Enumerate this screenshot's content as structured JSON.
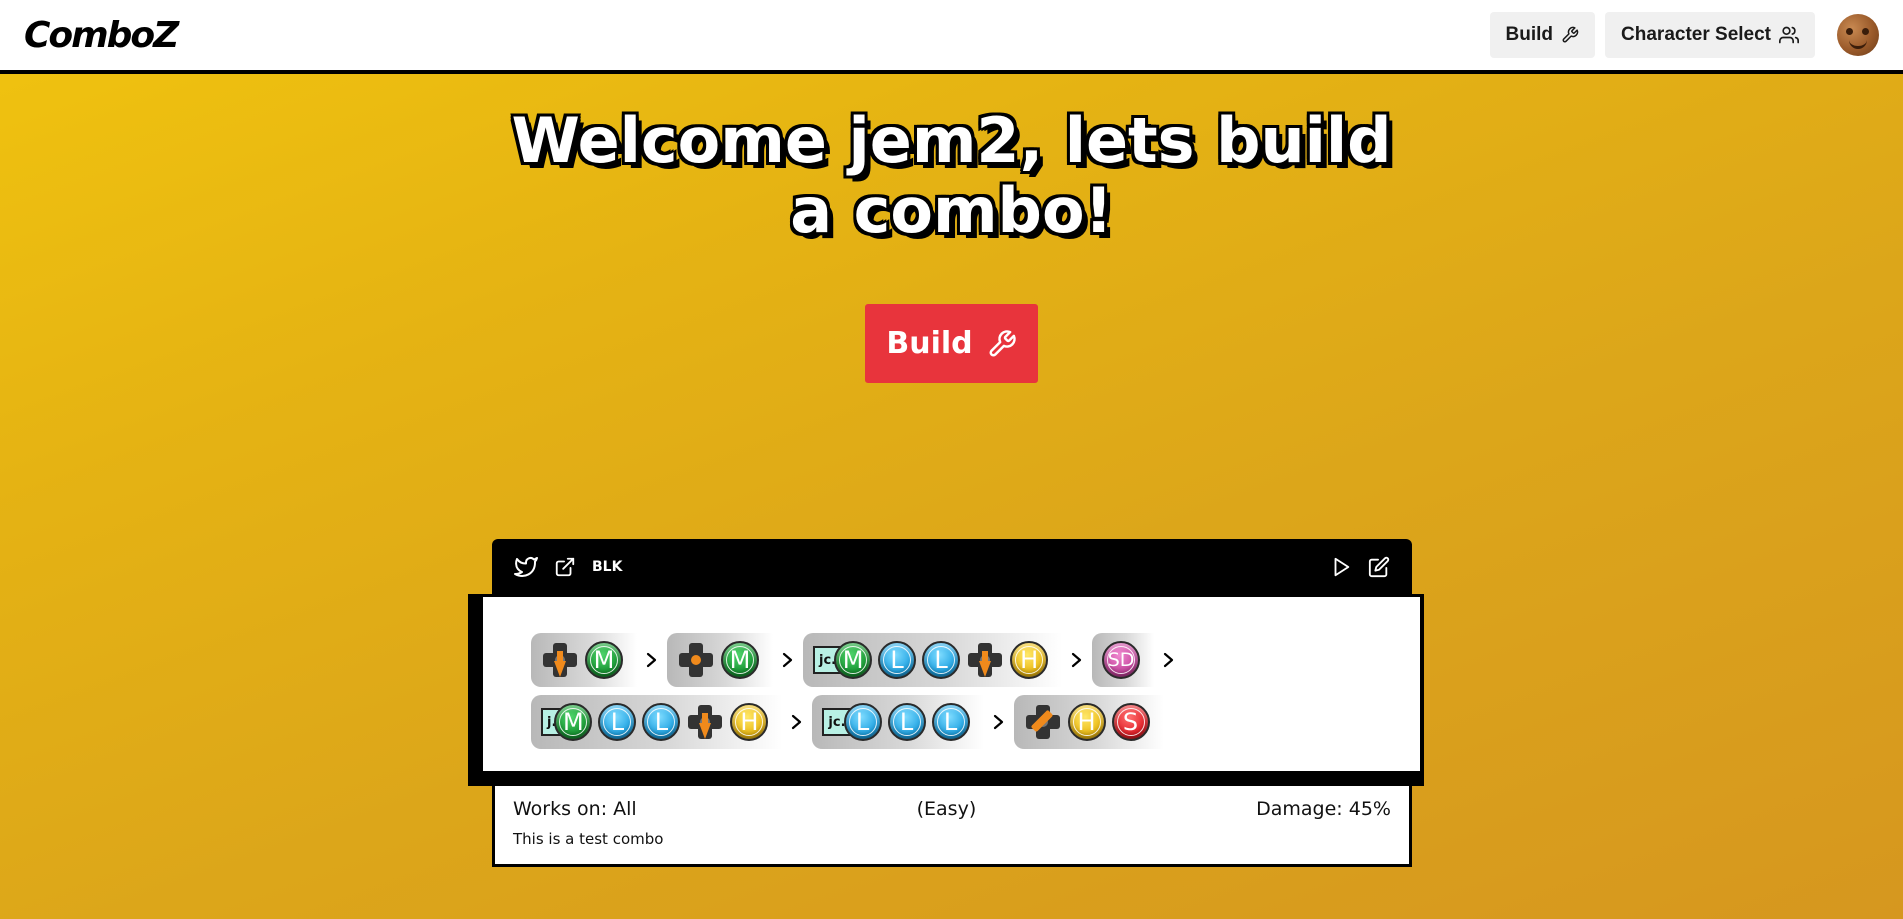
{
  "app": {
    "logo_text": "ComboZ"
  },
  "nav": {
    "build_label": "Build",
    "build_icon": "wrench-icon",
    "character_select_label": "Character Select",
    "character_select_icon": "users-icon"
  },
  "hero": {
    "title_line1": "Welcome jem2, lets build",
    "title_line2": "a combo!",
    "build_button_label": "Build"
  },
  "combo_card": {
    "character_tag": "BLK",
    "header_icons_left": [
      "twitter-icon",
      "external-link-icon"
    ],
    "header_icons_right": [
      "play-icon",
      "edit-icon"
    ],
    "rows": [
      [
        [
          "down",
          "M"
        ],
        [
          "neutral",
          "M"
        ],
        [
          "jc.",
          "M",
          "L",
          "L",
          "down",
          "H"
        ],
        [
          "SD"
        ]
      ],
      [
        [
          "j.",
          "M",
          "L",
          "L",
          "down",
          "H"
        ],
        [
          "jc.",
          "L",
          "L",
          "L"
        ],
        [
          "forward-down",
          "H",
          "S"
        ]
      ]
    ],
    "works_on": "Works on: All",
    "difficulty": "(Easy)",
    "damage": "Damage: 45%",
    "description": "This is a test combo"
  },
  "colors": {
    "background_start": "#f1c40f",
    "background_end": "#d6971f",
    "build_button": "#e8343c",
    "medium": "#14922f",
    "light": "#1a9fe0",
    "heavy": "#eab70f",
    "special": "#e01a22",
    "super_dash": "#c2409a"
  }
}
